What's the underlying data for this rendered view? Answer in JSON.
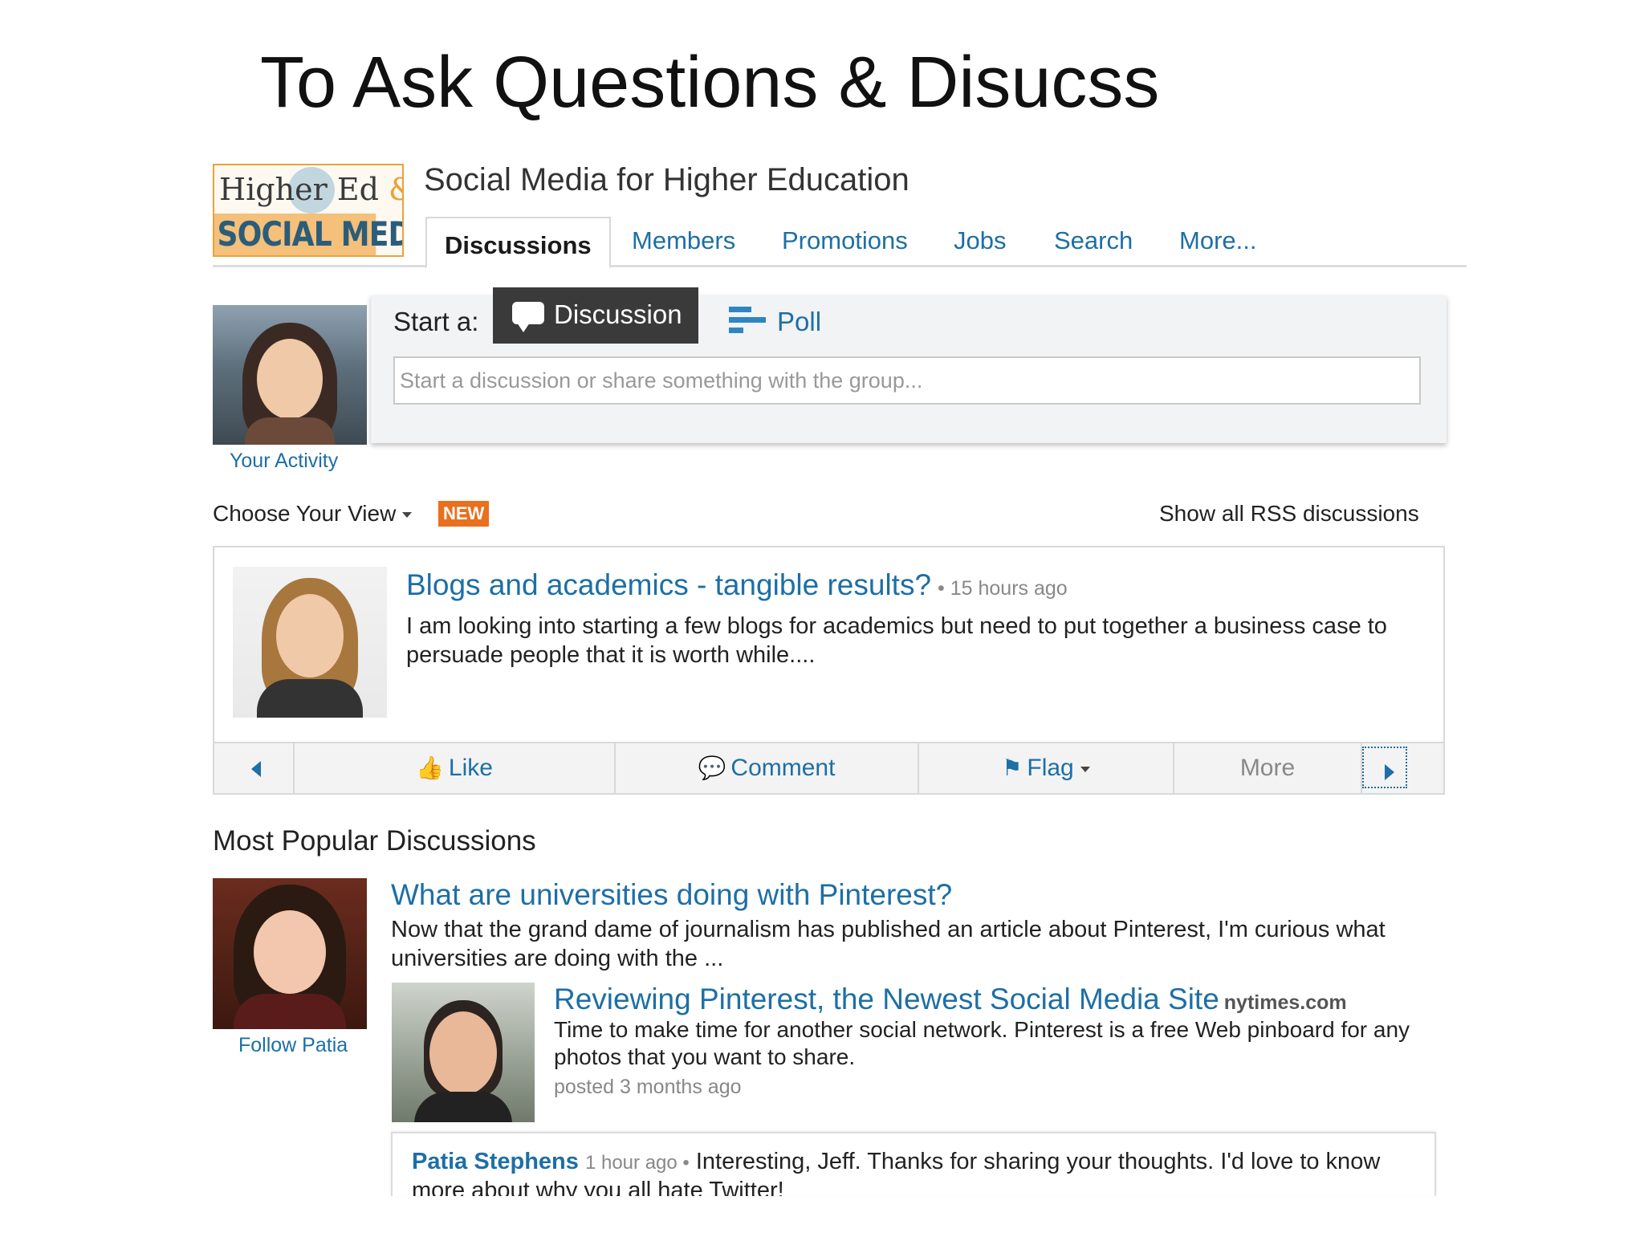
{
  "slide": {
    "title": "To Ask Questions & Disucss"
  },
  "logo": {
    "top_text": "Higher Ed",
    "amp": "&",
    "bottom_text": "SOCIAL MEDIA"
  },
  "group": {
    "name": "Social Media for Higher Education",
    "tabs": [
      "Discussions",
      "Members",
      "Promotions",
      "Jobs",
      "Search",
      "More..."
    ],
    "active_tab": "Discussions"
  },
  "composer": {
    "your_activity": "Your Activity",
    "start_label": "Start a:",
    "discussion_label": "Discussion",
    "poll_label": "Poll",
    "placeholder": "Start a discussion or share something with the group..."
  },
  "view": {
    "choose_view": "Choose Your View",
    "badge": "NEW",
    "rss": "Show all RSS discussions"
  },
  "featured": {
    "title": "Blogs and academics - tangible results?",
    "time": "• 15 hours ago",
    "body": "I am looking into starting a few blogs for academics but need to put together a business case to persuade people that it is worth while....",
    "actions": {
      "like": "Like",
      "comment": "Comment",
      "flag": "Flag",
      "more": "More"
    }
  },
  "popular": {
    "heading": "Most Popular Discussions",
    "follow": "Follow Patia",
    "title": "What are universities doing with Pinterest?",
    "body": "Now that the grand dame of journalism has published an article about Pinterest, I'm curious what universities are doing with the ...",
    "link": {
      "title": "Reviewing Pinterest, the Newest Social Media Site",
      "source": "nytimes.com",
      "body": "Time to make time for another social network. Pinterest is a free Web pinboard for any photos that you want to share.",
      "posted": "posted 3 months ago"
    },
    "comment": {
      "author": "Patia Stephens",
      "time": "1 hour ago •",
      "text": "Interesting, Jeff. Thanks for sharing your thoughts. I'd love to know more about why you all hate Twitter!"
    }
  },
  "colors": {
    "link": "#1d6fa5",
    "badge": "#e8701e",
    "dark_button": "#3a3a3a"
  }
}
